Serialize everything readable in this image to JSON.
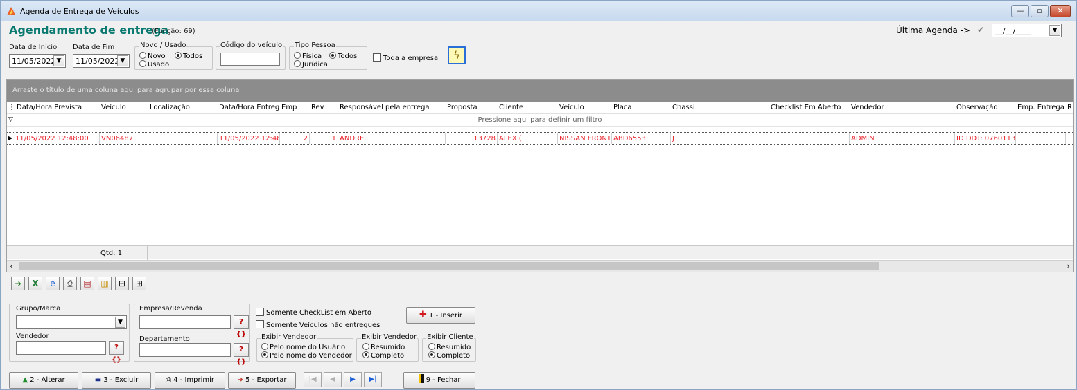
{
  "window": {
    "title": "Agenda de Entrega de Veículos"
  },
  "header": {
    "title": "Agendamento de entrega",
    "function_label": "(Função: 69)",
    "last_agenda_label": "Última Agenda ->",
    "last_agenda_value": "__/__/____"
  },
  "filters": {
    "start_date_label": "Data de Início",
    "start_date": "11/05/2022",
    "end_date_label": "Data de Fim",
    "end_date": "11/05/2022",
    "new_used_label": "Novo / Usado",
    "new_label": "Novo",
    "all_label": "Todos",
    "used_label": "Usado",
    "vehicle_code_label": "Código do veículo",
    "person_type_label": "Tipo Pessoa",
    "physical_label": "Física",
    "legal_label": "Jurídica",
    "person_all_label": "Todos",
    "whole_company_label": "Toda a empresa"
  },
  "grid": {
    "group_hint": "Arraste o título de uma coluna aqui para agrupar por essa coluna",
    "filter_hint": "Pressione aqui para definir um filtro",
    "columns": [
      "Data/Hora Prevista",
      "Veículo",
      "Localização",
      "Data/Hora Entreg",
      "Emp",
      "Rev",
      "Responsável pela entrega",
      "Proposta",
      "Cliente",
      "Veículo",
      "Placa",
      "Chassi",
      "Checklist Em Aberto",
      "Vendedor",
      "Observação",
      "Emp. Entrega",
      "R"
    ],
    "rows": [
      [
        "11/05/2022 12:48:00",
        "VN06487",
        "",
        "11/05/2022 12:48",
        "2",
        "1",
        "ANDRE.",
        "13728",
        "ALEX (",
        "NISSAN FRONT",
        "ABD6553",
        "J",
        "",
        "ADMIN",
        "ID DDT: 0760113:",
        "",
        ""
      ]
    ],
    "count_label": "Qtd: 1"
  },
  "bottom": {
    "brand_group_label": "Grupo/Marca",
    "company_label": "Empresa/Revenda",
    "seller_label": "Vendedor",
    "department_label": "Departamento",
    "only_checklist_label": "Somente CheckList em Aberto",
    "only_not_delivered_label": "Somente Veículos não entregues",
    "show_seller_label": "Exibir Vendedor",
    "by_user_name": "Pelo nome do Usuário",
    "by_seller_name": "Pelo nome do Vendedor",
    "show_seller2_label": "Exibir Vendedor",
    "summary_label": "Resumido",
    "complete_label": "Completo",
    "show_client_label": "Exibir Cliente",
    "client_summary_label": "Resumido",
    "client_complete_label": "Completo",
    "insert_label": "1 - Inserir"
  },
  "actions": {
    "edit_label": "2 - Alterar",
    "delete_label": "3 - Excluir",
    "print_label": "4 - Imprimir",
    "export_label": "5 - Exportar",
    "close_label": "9 - Fechar"
  },
  "colors": {
    "accent": "#0a7a70",
    "row_text": "#e8232b"
  }
}
